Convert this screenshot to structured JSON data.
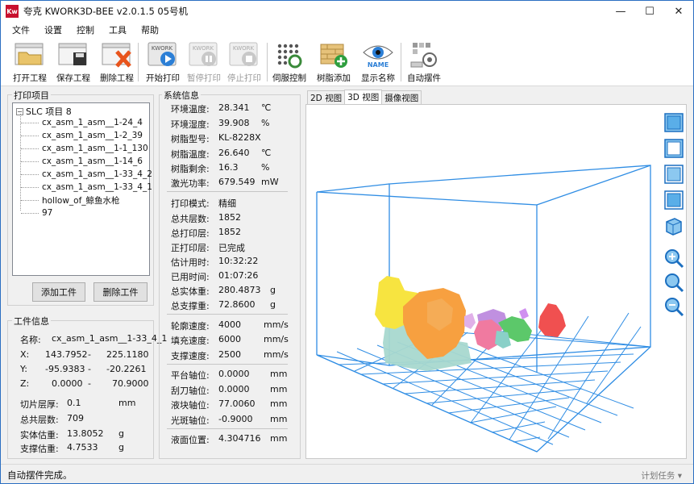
{
  "window": {
    "app_icon": "Kw",
    "title": "夸克  KWORK3D-BEE v2.0.1.5  05号机",
    "minimize": "—",
    "maximize": "☐",
    "close": "✕"
  },
  "menu": [
    "文件",
    "设置",
    "控制",
    "工具",
    "帮助"
  ],
  "toolbar": {
    "open": "打开工程",
    "save": "保存工程",
    "delete": "删除工程",
    "start": "开始打印",
    "pause": "暂停打印",
    "stop": "停止打印",
    "servo": "伺服控制",
    "add_support": "树脂添加",
    "show_name": "显示名称",
    "auto_place": "自动摆件",
    "kwork_badge": "KWORK",
    "name_badge": "NAME"
  },
  "project": {
    "section_title": "打印项目",
    "root_label": "SLC 项目  8",
    "tree_expand": "−",
    "items": [
      "cx_asm_1_asm__1-24_4",
      "cx_asm_1_asm__1-2_39",
      "cx_asm_1_asm__1-1_130",
      "cx_asm_1_asm__1-14_6",
      "cx_asm_1_asm__1-33_4_2",
      "cx_asm_1_asm__1-33_4_1",
      "hollow_of_鲸鱼水枪",
      "97"
    ],
    "add_button": "添加工件",
    "remove_button": "删除工件"
  },
  "part": {
    "section_title": "工件信息",
    "name_label": "名称:",
    "name_value": "cx_asm_1_asm__1-33_4_1",
    "x_label": "X:",
    "x_min": "143.7952",
    "x_sep": "-",
    "x_max": "225.1180",
    "y_label": "Y:",
    "y_min": "-95.9383",
    "y_sep": "-",
    "y_max": "-20.2261",
    "z_label": "Z:",
    "z_min": "0.0000",
    "z_sep": "-",
    "z_max": "70.9000",
    "layer_label": "切片层厚:",
    "layer_value": "0.1",
    "layer_unit": "mm",
    "total_layers_label": "总共层数:",
    "total_layers_value": "709",
    "solid_label": "实体估重:",
    "solid_value": "13.8052",
    "solid_unit": "g",
    "support_label": "支撑估重:",
    "support_value": "4.7533",
    "support_unit": "g"
  },
  "system": {
    "section_title": "系统信息",
    "env_temp_label": "环境温度:",
    "env_temp_value": "28.341",
    "env_temp_unit": "℃",
    "env_hum_label": "环境湿度:",
    "env_hum_value": "39.908",
    "env_hum_unit": "%",
    "resin_model_label": "树脂型号:",
    "resin_model_value": "KL-8228X",
    "resin_temp_label": "树脂温度:",
    "resin_temp_value": "26.640",
    "resin_temp_unit": "℃",
    "resin_left_label": "树脂剩余:",
    "resin_left_value": "16.3",
    "resin_left_unit": "%",
    "laser_label": "激光功率:",
    "laser_value": "679.549",
    "laser_unit": "mW",
    "mode_label": "打印模式:",
    "mode_value": "精细",
    "total_layers_label": "总共层数:",
    "total_layers_value": "1852",
    "printed_layers_label": "总打印层:",
    "printed_layers_value": "1852",
    "current_layer_label": "正打印层:",
    "current_layer_value": "已完成",
    "est_time_label": "估计用时:",
    "est_time_value": "10:32:22",
    "used_time_label": "已用时间:",
    "used_time_value": "01:07:26",
    "solid_weight_label": "总实体重:",
    "solid_weight_value": "280.4873",
    "solid_weight_unit": "g",
    "support_weight_label": "总支撑重:",
    "support_weight_value": "72.8600",
    "support_weight_unit": "g",
    "contour_speed_label": "轮廓速度:",
    "contour_speed_value": "4000",
    "contour_speed_unit": "mm/s",
    "fill_speed_label": "填充速度:",
    "fill_speed_value": "6000",
    "fill_speed_unit": "mm/s",
    "support_speed_label": "支撑速度:",
    "support_speed_value": "2500",
    "support_speed_unit": "mm/s",
    "platform_label": "平台轴位:",
    "platform_value": "0.0000",
    "platform_unit": "mm",
    "scraper_label": "刮刀轴位:",
    "scraper_value": "0.0000",
    "scraper_unit": "mm",
    "liquid_block_label": "液块轴位:",
    "liquid_block_value": "77.0060",
    "liquid_block_unit": "mm",
    "spot_label": "光斑轴位:",
    "spot_value": "-0.9000",
    "spot_unit": "mm",
    "liquid_level_label": "液面位置:",
    "liquid_level_value": "4.304716",
    "liquid_level_unit": "mm"
  },
  "view": {
    "tabs": [
      "2D 视图",
      "3D 视图",
      "摄像视图"
    ],
    "active_tab": "3D 视图"
  },
  "status": {
    "message": "自动摆件完成。",
    "right": "计划任务 ▾"
  },
  "colors": {
    "grid": "#2f8de4",
    "yellow": "#f7e440",
    "orange": "#f7a040",
    "teal": "#a8d8cf",
    "pink": "#f07aa0",
    "purple": "#c090e0",
    "green": "#5cc86a",
    "red": "#f05050"
  }
}
